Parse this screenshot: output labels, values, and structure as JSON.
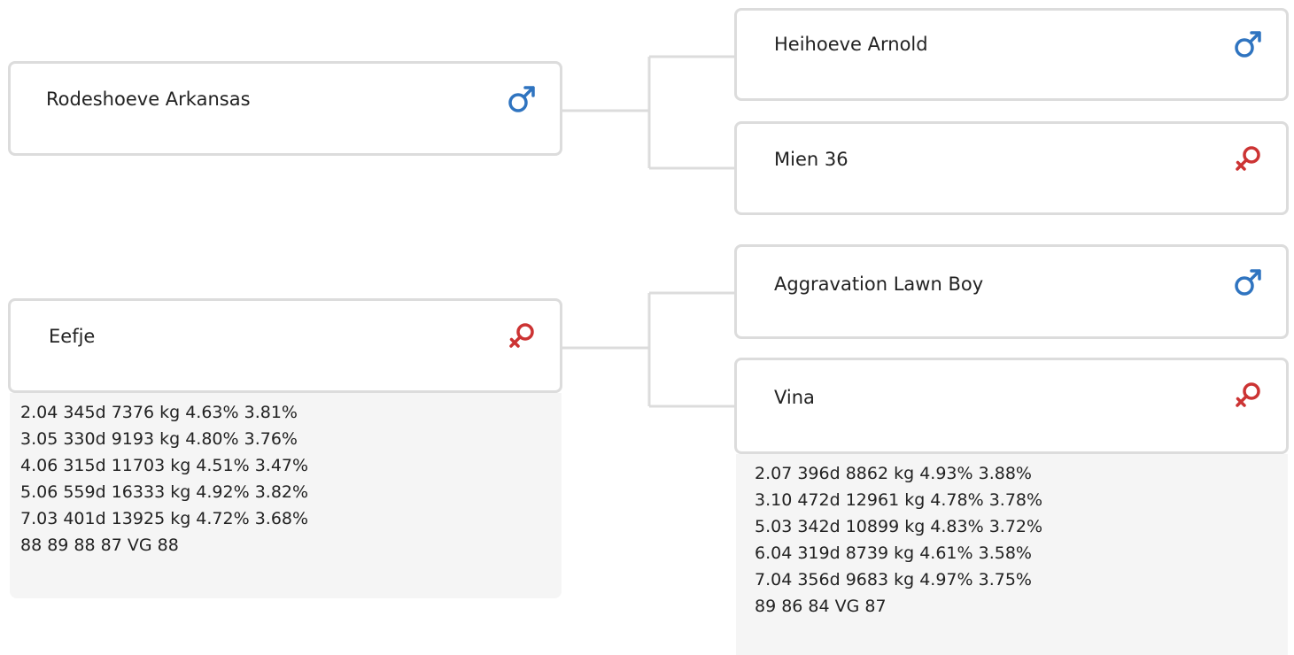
{
  "pedigree": {
    "sire": {
      "name": "Rodeshoeve Arkansas",
      "sex": "male",
      "sex_icon": "male-icon",
      "sire": {
        "name": "Heihoeve Arnold",
        "sex": "male",
        "sex_icon": "male-icon"
      },
      "dam": {
        "name": "Mien 36",
        "sex": "female",
        "sex_icon": "female-icon"
      }
    },
    "dam": {
      "name": "Eefje",
      "sex": "female",
      "sex_icon": "female-icon",
      "stats": [
        "2.04 345d 7376 kg 4.63% 3.81%",
        "3.05 330d 9193 kg 4.80% 3.76%",
        "4.06 315d 11703 kg 4.51% 3.47%",
        "5.06 559d 16333 kg 4.92% 3.82%",
        "7.03 401d 13925 kg 4.72% 3.68%",
        "88 89 88 87 VG 88"
      ],
      "sire": {
        "name": "Aggravation Lawn Boy",
        "sex": "male",
        "sex_icon": "male-icon"
      },
      "dam": {
        "name": "Vina",
        "sex": "female",
        "sex_icon": "female-icon",
        "stats": [
          "2.07 396d 8862 kg 4.93% 3.88%",
          "3.10 472d 12961 kg 4.78% 3.78%",
          "5.03 342d 10899 kg 4.83% 3.72%",
          "6.04 319d 8739 kg 4.61% 3.58%",
          "7.04 356d 9683 kg 4.97% 3.75%",
          "89 86 84 VG 87"
        ]
      }
    }
  },
  "colors": {
    "male": "#2f74c0",
    "female": "#cc3333",
    "card_border": "#dcdcdc",
    "connector": "#dcdcdc",
    "stats_bg": "#f5f5f5"
  }
}
